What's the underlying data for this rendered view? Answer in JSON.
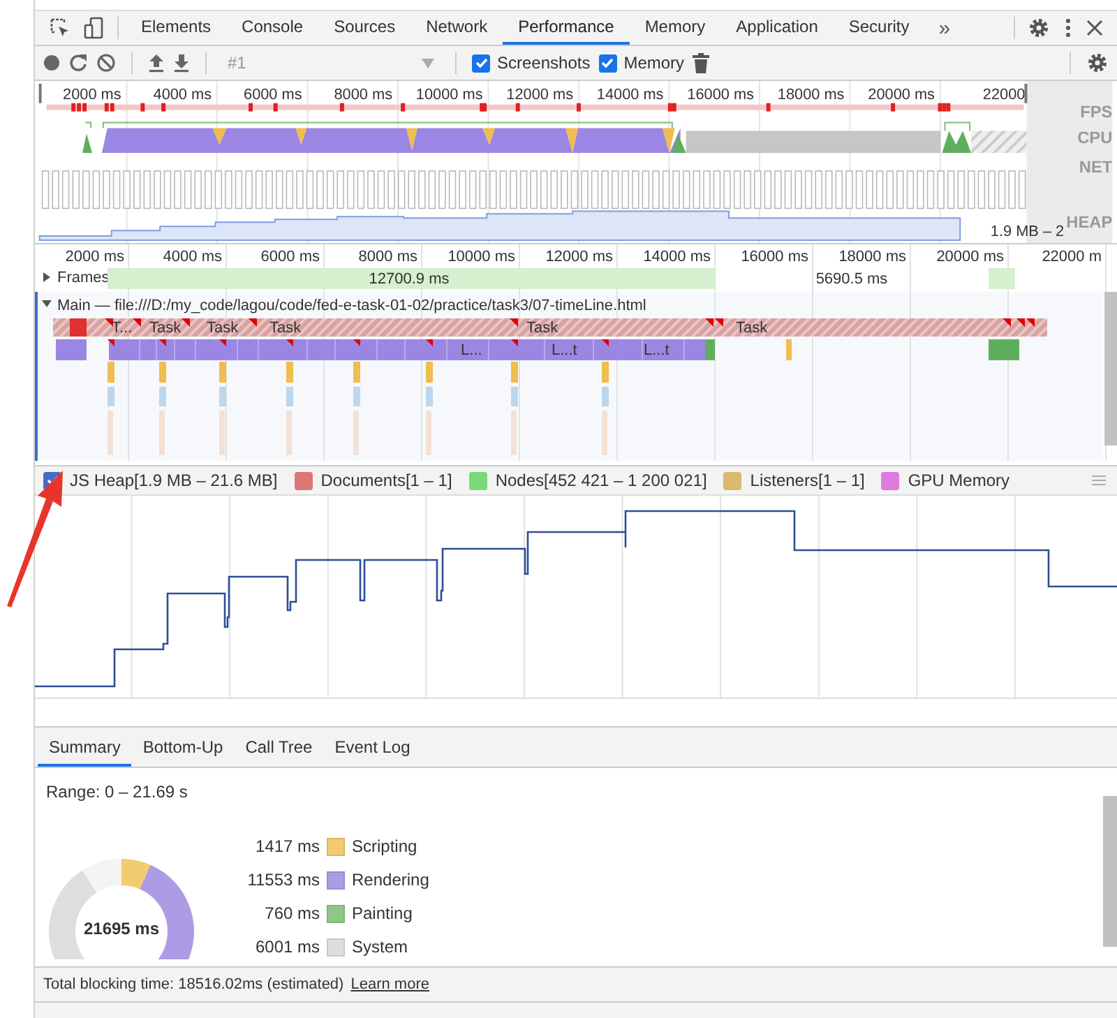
{
  "tabs": [
    {
      "label": "Elements",
      "selected": false
    },
    {
      "label": "Console",
      "selected": false
    },
    {
      "label": "Sources",
      "selected": false
    },
    {
      "label": "Network",
      "selected": false
    },
    {
      "label": "Performance",
      "selected": true
    },
    {
      "label": "Memory",
      "selected": false
    },
    {
      "label": "Application",
      "selected": false
    },
    {
      "label": "Security",
      "selected": false
    }
  ],
  "more_tabs": "»",
  "toolbar": {
    "recording": "#1",
    "checkboxes": [
      {
        "label": "Screenshots",
        "checked": true
      },
      {
        "label": "Memory",
        "checked": true
      }
    ]
  },
  "overview": {
    "ticks": [
      "2000 ms",
      "4000 ms",
      "6000 ms",
      "8000 ms",
      "10000 ms",
      "12000 ms",
      "14000 ms",
      "16000 ms",
      "18000 ms",
      "20000 ms",
      "22000"
    ],
    "lanes": [
      "FPS",
      "CPU",
      "NET",
      "HEAP"
    ],
    "heap_range": "1.9 MB – 2"
  },
  "flame": {
    "ticks": [
      "2000 ms",
      "4000 ms",
      "6000 ms",
      "8000 ms",
      "10000 ms",
      "12000 ms",
      "14000 ms",
      "16000 ms",
      "18000 ms",
      "20000 ms",
      "22000 m"
    ],
    "frames": {
      "label": "Frames",
      "expanded": false,
      "segments": [
        "12700.9 ms",
        "5690.5 ms"
      ]
    },
    "main": {
      "label": "Main — file:///D:/my_code/lagou/code/fed-e-task-01-02/practice/task3/07-timeLine.html",
      "expanded": true,
      "tasks": [
        "T...",
        "Task",
        "Task",
        "Task",
        "Task",
        "Task"
      ],
      "subtasks": [
        "L...",
        "L...t",
        "L...t"
      ]
    }
  },
  "memory_legend": [
    {
      "label": "JS Heap[1.9 MB – 21.6 MB]",
      "checked": true,
      "color": "#4a68c8"
    },
    {
      "label": "Documents[1 – 1]",
      "checked": false,
      "color": "#de7676"
    },
    {
      "label": "Nodes[452 421 – 1 200 021]",
      "checked": false,
      "color": "#7ad97a"
    },
    {
      "label": "Listeners[1 – 1]",
      "checked": false,
      "color": "#dcb870"
    },
    {
      "label": "GPU Memory",
      "checked": false,
      "color": "#dc7ce0"
    }
  ],
  "bottom_tabs": [
    {
      "label": "Summary",
      "selected": true
    },
    {
      "label": "Bottom-Up",
      "selected": false
    },
    {
      "label": "Call Tree",
      "selected": false
    },
    {
      "label": "Event Log",
      "selected": false
    }
  ],
  "summary": {
    "range": "Range: 0 – 21.69 s",
    "total": "21695 ms",
    "items": [
      {
        "time": "1417 ms",
        "label": "Scripting",
        "color": "#f2cc6e"
      },
      {
        "time": "11553 ms",
        "label": "Rendering",
        "color": "#ae9be6"
      },
      {
        "time": "760 ms",
        "label": "Painting",
        "color": "#8fc787"
      },
      {
        "time": "6001 ms",
        "label": "System",
        "color": "#dedede"
      }
    ]
  },
  "footer": {
    "text": "Total blocking time: 18516.02ms (estimated)",
    "link": "Learn more"
  }
}
